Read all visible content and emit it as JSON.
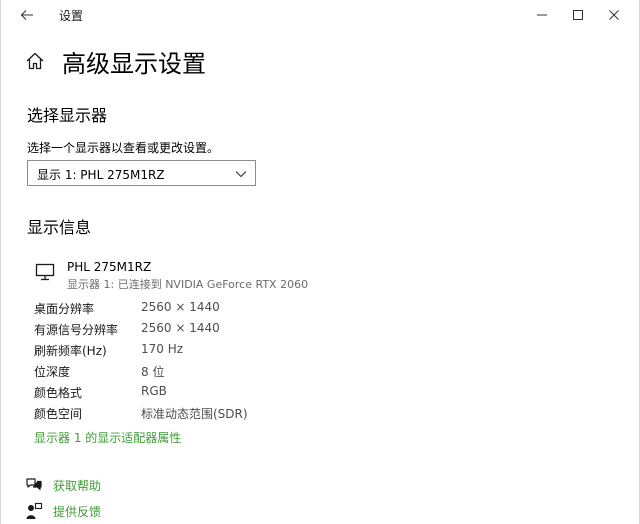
{
  "window": {
    "title": "设置"
  },
  "header": {
    "page_title": "高级显示设置"
  },
  "select_display": {
    "heading": "选择显示器",
    "description": "选择一个显示器以查看或更改设置。",
    "selected_value": "显示 1: PHL 275M1RZ"
  },
  "display_info": {
    "heading": "显示信息",
    "monitor_name": "PHL 275M1RZ",
    "monitor_connection": "显示器 1: 已连接到 NVIDIA GeForce RTX 2060",
    "rows": [
      {
        "label": "桌面分辨率",
        "value": "2560 × 1440"
      },
      {
        "label": "有源信号分辨率",
        "value": "2560 × 1440"
      },
      {
        "label": "刷新频率(Hz)",
        "value": "170 Hz"
      },
      {
        "label": "位深度",
        "value": "8 位"
      },
      {
        "label": "颜色格式",
        "value": "RGB"
      },
      {
        "label": "颜色空间",
        "value": "标准动态范围(SDR)"
      }
    ],
    "adapter_link": "显示器 1 的显示适配器属性"
  },
  "help": {
    "get_help": "获取帮助",
    "feedback": "提供反馈"
  },
  "colors": {
    "accent_link": "#3f9c35",
    "secondary_text": "#6b6b6b",
    "dropdown_border": "#8c8c8c"
  },
  "icons": {
    "back": "back-arrow-icon",
    "minimize": "minimize-icon",
    "maximize": "maximize-icon",
    "close": "close-icon",
    "home": "home-icon",
    "dropdown": "chevron-down-icon",
    "monitor": "monitor-icon",
    "get_help": "chat-bubbles-icon",
    "feedback": "person-feedback-icon"
  }
}
